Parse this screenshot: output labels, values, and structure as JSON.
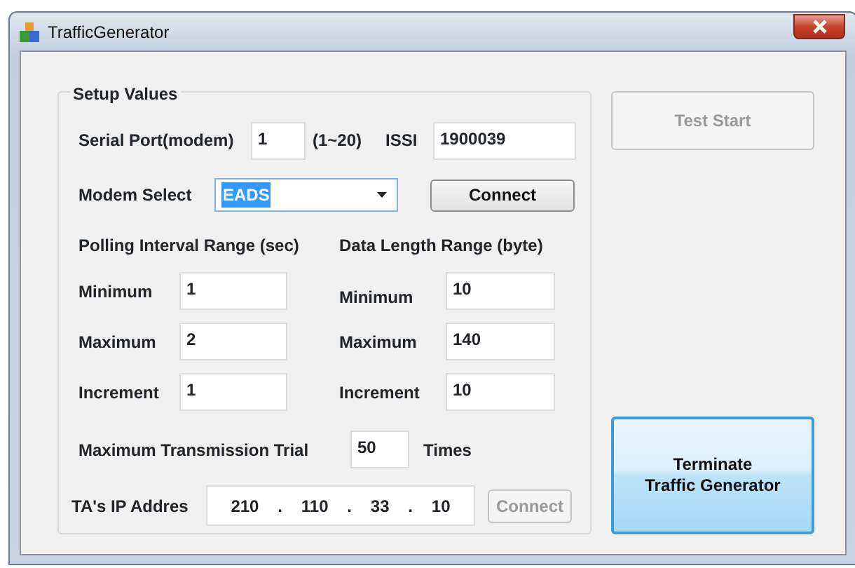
{
  "window": {
    "title": "TrafficGenerator"
  },
  "setup": {
    "title": "Setup Values",
    "serial_port": {
      "label": "Serial Port(modem)",
      "value": "1",
      "hint": "(1~20)"
    },
    "issi": {
      "label": "ISSI",
      "value": "1900039"
    },
    "modem_select": {
      "label": "Modem Select",
      "value": "EADS",
      "highlighted": true
    },
    "connect_button": {
      "label": "Connect",
      "disabled": false
    },
    "ranges": [
      {
        "title": "Polling Interval Range (sec)",
        "fields": [
          {
            "label": "Minimum",
            "value": "1"
          },
          {
            "label": "Maximum",
            "value": "2"
          },
          {
            "label": "Increment",
            "value": "1"
          }
        ]
      },
      {
        "title": "Data Length Range (byte)",
        "fields": [
          {
            "label": "Minimum",
            "value": "10"
          },
          {
            "label": "Maximum",
            "value": "140"
          },
          {
            "label": "Increment",
            "value": "10"
          }
        ]
      }
    ],
    "max_trial": {
      "label": "Maximum Transmission Trial",
      "value": "50",
      "unit": "Times"
    },
    "ip": {
      "label": "TA's IP Addres",
      "octets": [
        "210",
        "110",
        "33",
        "10"
      ],
      "separator": "."
    },
    "ip_connect_button": {
      "label": "Connect",
      "disabled": true
    }
  },
  "buttons": [
    {
      "lines": [
        "Test Start"
      ],
      "disabled": true,
      "kind": "plain"
    },
    {
      "lines": [
        "Terminate",
        "Traffic Generator"
      ],
      "disabled": false,
      "kind": "focused"
    }
  ]
}
